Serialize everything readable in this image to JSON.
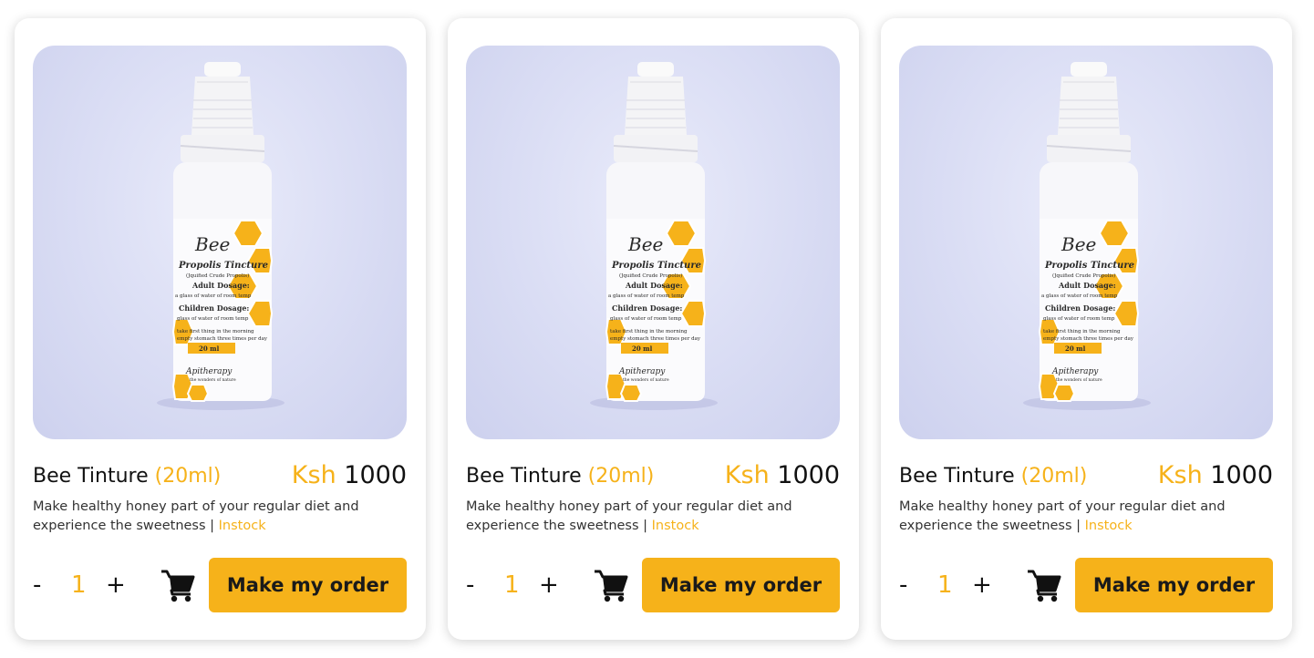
{
  "colors": {
    "accent": "#f6b21a",
    "text": "#111111",
    "card_bg": "#ffffff",
    "photo_bg": "#dcdff5"
  },
  "products": [
    {
      "name": "Bee Tinture",
      "size": "(20ml)",
      "currency": "Ksh",
      "price": "1000",
      "description": "Make healthy honey part of your regular diet and experience the sweetness |",
      "stock": "Instock",
      "quantity": "1",
      "minus_label": "-",
      "plus_label": "+",
      "cart_icon": "shopping-cart-icon",
      "order_label": "Make my order",
      "image_alt": "Bee Propolis Tincture bottle"
    },
    {
      "name": "Bee Tinture",
      "size": "(20ml)",
      "currency": "Ksh",
      "price": "1000",
      "description": "Make healthy honey part of your regular diet and experience the sweetness |",
      "stock": "Instock",
      "quantity": "1",
      "minus_label": "-",
      "plus_label": "+",
      "cart_icon": "shopping-cart-icon",
      "order_label": "Make my order",
      "image_alt": "Bee Propolis Tincture bottle"
    },
    {
      "name": "Bee Tinture",
      "size": "(20ml)",
      "currency": "Ksh",
      "price": "1000",
      "description": "Make healthy honey part of your regular diet and experience the sweetness |",
      "stock": "Instock",
      "quantity": "1",
      "minus_label": "-",
      "plus_label": "+",
      "cart_icon": "shopping-cart-icon",
      "order_label": "Make my order",
      "image_alt": "Bee Propolis Tincture bottle"
    }
  ],
  "label_text": {
    "brand": "Bee",
    "product": "Propolis Tincture",
    "sub": "(Jquified Crude Propolis)",
    "adult": "Adult Dosage:",
    "adult_line": "a glass of water of room temp",
    "children": "Children Dosage:",
    "children_line": "glass of water of room temp",
    "usage1": "take first thing in the morning",
    "usage2": "empty stomach three times per day",
    "volume": "20 ml",
    "apitherapy": "Apitherapy",
    "tagline": "the wonders of nature"
  }
}
